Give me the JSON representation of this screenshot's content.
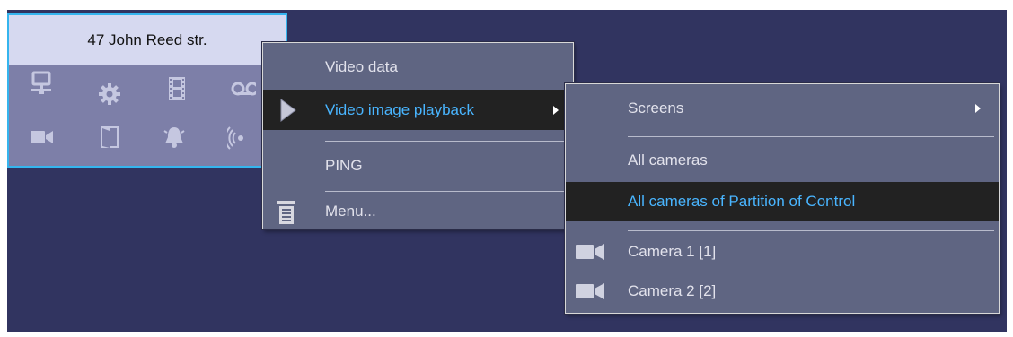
{
  "tile": {
    "title": "47 John Reed str.",
    "icons": [
      "network-icon",
      "gear-icon",
      "film-icon",
      "audio-tape-icon",
      "camera-icon",
      "door-icon",
      "alarm-bell-icon",
      "wireless-icon"
    ]
  },
  "menu": {
    "items": [
      {
        "label": "Video data"
      },
      {
        "label": "Video image playback",
        "highlighted": true,
        "has_submenu": true
      },
      {
        "label": "PING"
      },
      {
        "label": "Menu..."
      }
    ]
  },
  "submenu": {
    "items": [
      {
        "label": "Screens",
        "has_submenu": true
      },
      {
        "label": "All cameras"
      },
      {
        "label": "All cameras of Partition of Control",
        "highlighted": true
      },
      {
        "label": "Camera 1 [1]",
        "icon": "camera-icon"
      },
      {
        "label": "Camera 2 [2]",
        "icon": "camera-icon"
      }
    ]
  },
  "colors": {
    "background": "#313460",
    "tile_border": "#35b5ee",
    "highlight_text": "#49b5ff",
    "highlight_bg": "#222222"
  }
}
